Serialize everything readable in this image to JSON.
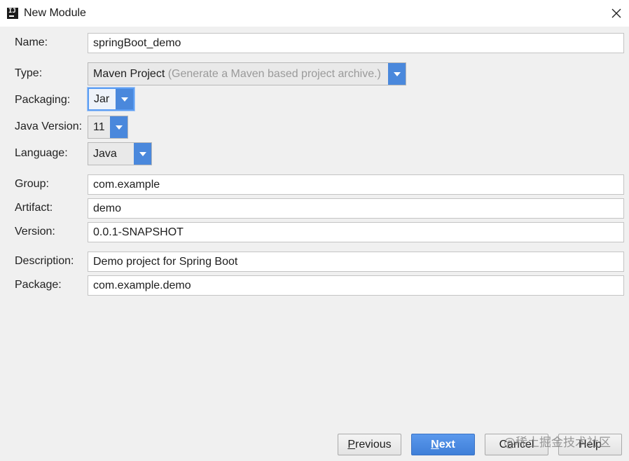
{
  "window": {
    "title": "New Module",
    "icon_text": "IJ"
  },
  "form": {
    "name": {
      "label": "Name:",
      "value": "springBoot_demo"
    },
    "type": {
      "label": "Type:",
      "value": "Maven Project",
      "hint": "(Generate a Maven based project archive.)"
    },
    "packaging": {
      "label": "Packaging:",
      "value": "Jar"
    },
    "java_version": {
      "label": "Java Version:",
      "value": "11"
    },
    "language": {
      "label": "Language:",
      "value": "Java"
    },
    "group": {
      "label": "Group:",
      "value": "com.example"
    },
    "artifact": {
      "label": "Artifact:",
      "value": "demo"
    },
    "version": {
      "label": "Version:",
      "value": "0.0.1-SNAPSHOT"
    },
    "description": {
      "label": "Description:",
      "value": "Demo project for Spring Boot"
    },
    "package": {
      "label": "Package:",
      "value": "com.example.demo"
    }
  },
  "buttons": {
    "previous": {
      "mnemonic": "P",
      "rest": "revious"
    },
    "next": {
      "mnemonic": "N",
      "rest": "ext"
    },
    "cancel": "Cancel",
    "help": "Help"
  },
  "watermark": "@稀土掘金技术社区",
  "colors": {
    "accent": "#4a88dc",
    "dialog_background": "#f0f0f0",
    "hint_text": "#9a9a9a"
  },
  "icons": {
    "close": "close-icon",
    "dropdown": "chevron-down-icon"
  }
}
